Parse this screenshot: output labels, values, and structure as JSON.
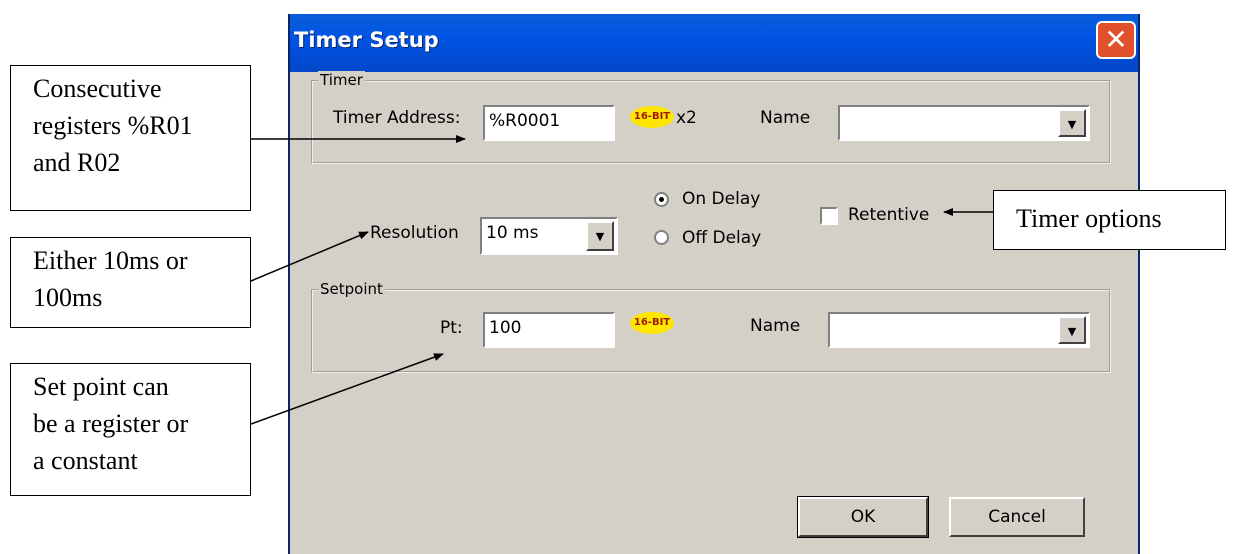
{
  "dialog": {
    "title": "Timer Setup",
    "close_glyph": "✕",
    "timer_group": {
      "legend": "Timer",
      "address_label": "Timer Address:",
      "address_value": "%R0001",
      "badge": "16-BIT",
      "multiplier": "x2",
      "name_label": "Name",
      "name_value": ""
    },
    "resolution": {
      "label": "Resolution",
      "value": "10 ms"
    },
    "mode": {
      "on_delay": "On Delay",
      "off_delay": "Off Delay",
      "selected": "On Delay"
    },
    "retentive": {
      "label": "Retentive",
      "checked": false
    },
    "setpoint_group": {
      "legend": "Setpoint",
      "pt_label": "Pt:",
      "pt_value": "100",
      "badge": "16-BIT",
      "name_label": "Name",
      "name_value": ""
    },
    "buttons": {
      "ok": "OK",
      "cancel": "Cancel"
    },
    "dropdown_arrow": "▼"
  },
  "callouts": {
    "consecutive": [
      "Consecutive",
      "registers %R01",
      "and R02"
    ],
    "resolution": [
      "Either 10ms or",
      "100ms"
    ],
    "setpoint": [
      "Set point can",
      "be a register or",
      "a constant"
    ],
    "options": [
      "Timer options"
    ]
  },
  "colors": {
    "titlebar": "#0054e3",
    "dialog_face": "#d4d0c8",
    "close_button": "#e0512b",
    "badge": "#ffe600"
  }
}
